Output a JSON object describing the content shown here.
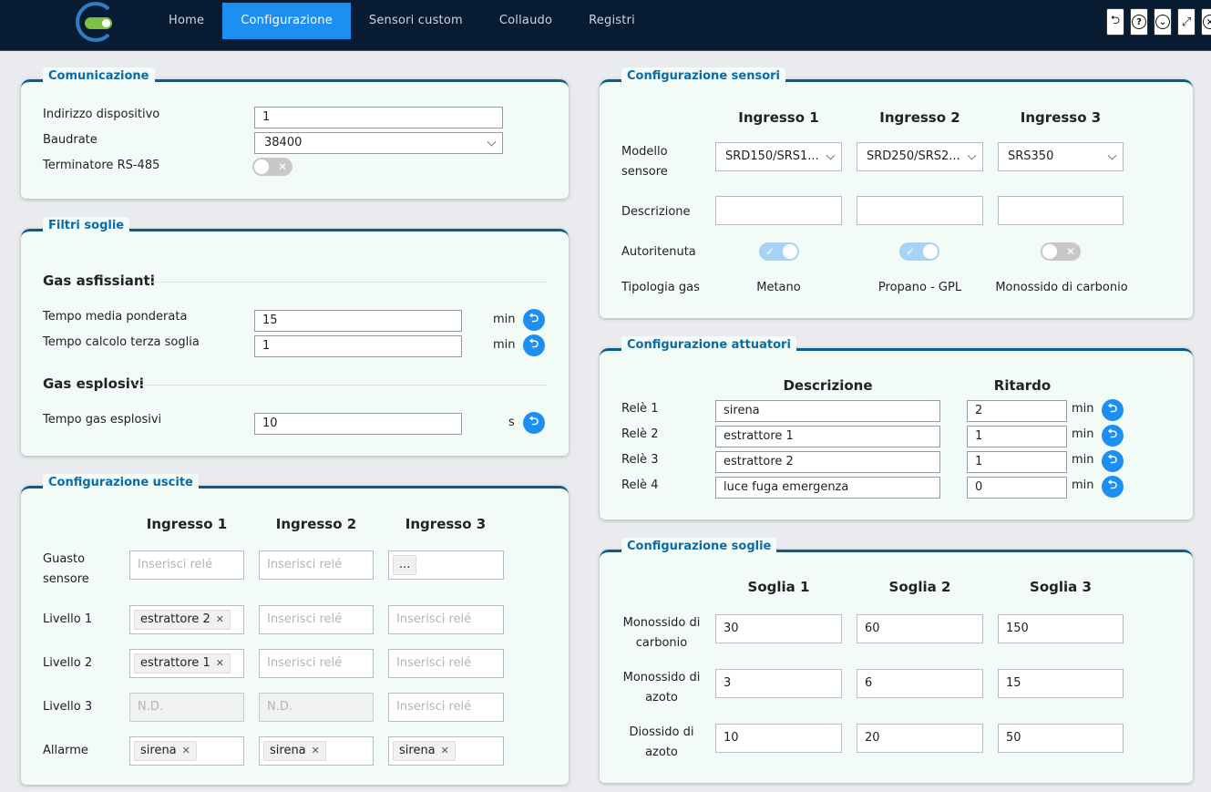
{
  "nav": {
    "items": [
      {
        "label": "Home",
        "active": false
      },
      {
        "label": "Configurazione",
        "active": true
      },
      {
        "label": "Sensori custom",
        "active": false
      },
      {
        "label": "Collaudo",
        "active": false
      },
      {
        "label": "Registri",
        "active": false
      }
    ],
    "tools": [
      "undo-icon",
      "help-icon",
      "chevron-down-circle-icon",
      "fullscreen-icon",
      "power-icon"
    ]
  },
  "comunicazione": {
    "title": "Comunicazione",
    "indirizzo_label": "Indirizzo dispositivo",
    "indirizzo_value": "1",
    "baudrate_label": "Baudrate",
    "baudrate_value": "38400",
    "terminatore_label": "Terminatore RS-485",
    "terminatore_on": false
  },
  "filtri": {
    "title": "Filtri soglie",
    "asfissianti_title": "Gas asfissianti",
    "media_label": "Tempo media ponderata",
    "media_value": "15",
    "media_unit": "min",
    "terza_label": "Tempo calcolo terza soglia",
    "terza_value": "1",
    "terza_unit": "min",
    "esplosivi_title": "Gas esplosivi",
    "esplosivi_label": "Tempo gas esplosivi",
    "esplosivi_value": "10",
    "esplosivi_unit": "s"
  },
  "uscite": {
    "title": "Configurazione uscite",
    "headers": [
      "Ingresso 1",
      "Ingresso 2",
      "Ingresso 3"
    ],
    "placeholder": "Inserisci relé",
    "na": "N.D.",
    "more": "...",
    "rows": [
      {
        "label_1": "Guasto",
        "label_2": "sensore"
      },
      {
        "label": "Livello 1",
        "tag": "estrattore 2"
      },
      {
        "label": "Livello 2",
        "tag": "estrattore 1"
      },
      {
        "label": "Livello 3"
      },
      {
        "label": "Allarme",
        "tag": "sirena"
      }
    ]
  },
  "sensori": {
    "title": "Configurazione sensori",
    "headers": [
      "Ingresso 1",
      "Ingresso 2",
      "Ingresso 3"
    ],
    "modello_label_1": "Modello",
    "modello_label_2": "sensore",
    "modelli": [
      "SRD150/SRS1...",
      "SRD250/SRS2...",
      "SRS350"
    ],
    "descrizione_label": "Descrizione",
    "autoritenuta_label": "Autoritenuta",
    "autoritenuta": [
      true,
      true,
      false
    ],
    "tipologia_label": "Tipologia gas",
    "tipologie": [
      "Metano",
      "Propano - GPL",
      "Monossido di carbonio"
    ]
  },
  "attuatori": {
    "title": "Configurazione attuatori",
    "header_desc": "Descrizione",
    "header_ritardo": "Ritardo",
    "unit": "min",
    "rows": [
      {
        "label": "Relè 1",
        "desc": "sirena",
        "ritardo": "2"
      },
      {
        "label": "Relè 2",
        "desc": "estrattore 1",
        "ritardo": "1"
      },
      {
        "label": "Relè 3",
        "desc": "estrattore 2",
        "ritardo": "1"
      },
      {
        "label": "Relè 4",
        "desc": "luce fuga emergenza",
        "ritardo": "0"
      }
    ]
  },
  "soglie": {
    "title": "Configurazione soglie",
    "headers": [
      "Soglia 1",
      "Soglia 2",
      "Soglia 3"
    ],
    "rows": [
      {
        "label_1": "Monossido di",
        "label_2": "carbonio",
        "values": [
          "30",
          "60",
          "150"
        ]
      },
      {
        "label_1": "Monossido di",
        "label_2": "azoto",
        "values": [
          "3",
          "6",
          "15"
        ]
      },
      {
        "label_1": "Diossido di",
        "label_2": "azoto",
        "values": [
          "10",
          "20",
          "50"
        ]
      }
    ]
  }
}
